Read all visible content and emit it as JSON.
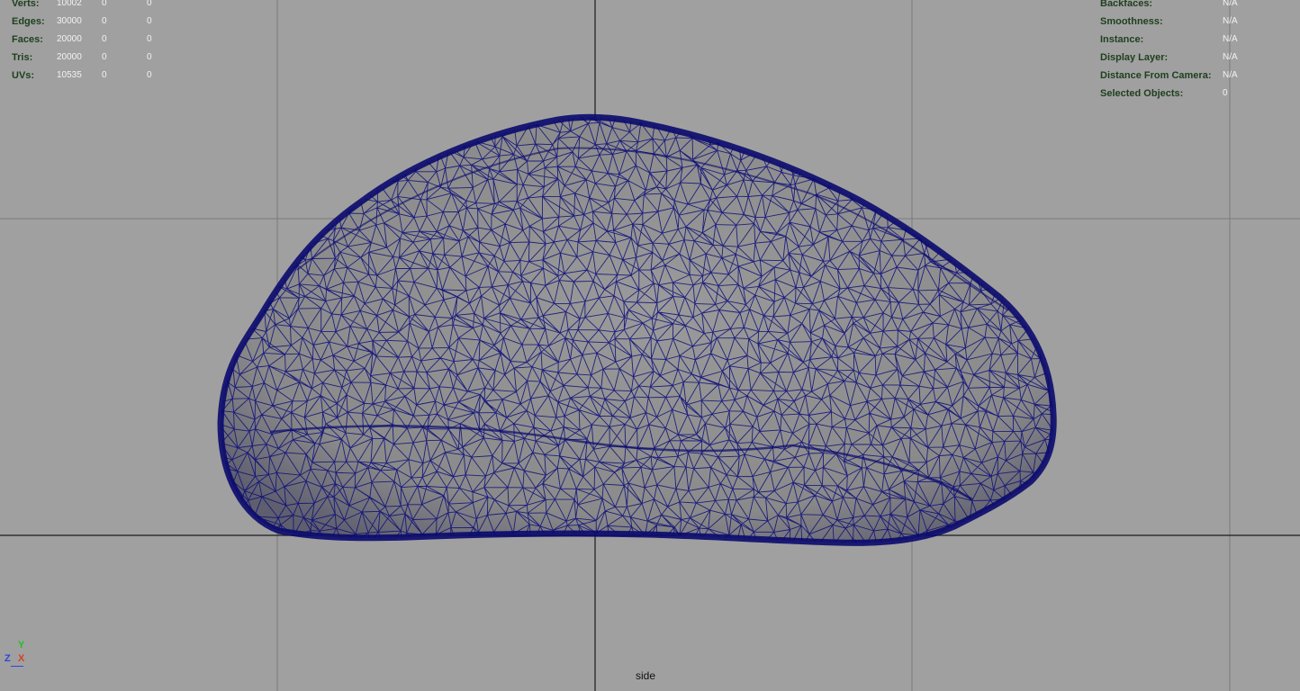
{
  "stats": {
    "rows": [
      {
        "label": "Verts:",
        "v1": "10002",
        "v2": "0",
        "v3": "0"
      },
      {
        "label": "Edges:",
        "v1": "30000",
        "v2": "0",
        "v3": "0"
      },
      {
        "label": "Faces:",
        "v1": "20000",
        "v2": "0",
        "v3": "0"
      },
      {
        "label": "Tris:",
        "v1": "20000",
        "v2": "0",
        "v3": "0"
      },
      {
        "label": "UVs:",
        "v1": "10535",
        "v2": "0",
        "v3": "0"
      }
    ]
  },
  "info": {
    "rows": [
      {
        "label": "Backfaces:",
        "value": "N/A"
      },
      {
        "label": "Smoothness:",
        "value": "N/A"
      },
      {
        "label": "Instance:",
        "value": "N/A"
      },
      {
        "label": "Display Layer:",
        "value": "N/A"
      },
      {
        "label": "Distance From Camera:",
        "value": "N/A"
      },
      {
        "label": "Selected Objects:",
        "value": "0"
      }
    ]
  },
  "axis": {
    "y": "Y",
    "z": "Z",
    "x": "X"
  },
  "camera": {
    "name": "side"
  },
  "colors": {
    "background": "#a0a0a0",
    "wireframe": "#0a0a7a",
    "mesh_fill": "#8c8c8c",
    "hud_label": "#1e3f1e",
    "hud_value": "#f2f2f2"
  },
  "icons": [
    "axis-indicator-icon"
  ]
}
